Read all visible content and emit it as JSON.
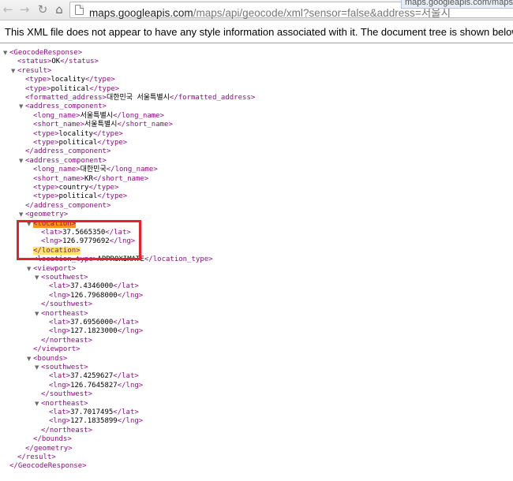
{
  "browser": {
    "url_host": "maps.googleapis.com",
    "url_path": "/maps/api/geocode/xml?sensor=false&address=서울시",
    "hover_url": "maps.googleapis.com/maps/api/"
  },
  "notice": "This XML file does not appear to have any style information associated with it. The document tree is shown below.",
  "xml_lines": [
    "<GeocodeResponse>",
    "<status>OK</status>",
    "<result>",
    "<type>locality</type>",
    "<type>political</type>",
    "<formatted_address>대한민국 서울특별시</formatted_address>",
    "<address_component>",
    "<long_name>서울특별시</long_name>",
    "<short_name>서울특별시</short_name>",
    "<type>locality</type>",
    "<type>political</type>",
    "</address_component>",
    "<address_component>",
    "<long_name>대한민국</long_name>",
    "<short_name>KR</short_name>",
    "<type>country</type>",
    "<type>political</type>",
    "</address_component>",
    "<geometry>",
    "<location>",
    "<lat>37.5665350</lat>",
    "<lng>126.9779692</lng>",
    "</location>",
    "<location_type>APPROXIMATE</location_type>",
    "<viewport>",
    "<southwest>",
    "<lat>37.4346000</lat>",
    "<lng>126.7968000</lng>",
    "</southwest>",
    "<northeast>",
    "<lat>37.6956000</lat>",
    "<lng>127.1823000</lng>",
    "</northeast>",
    "</viewport>",
    "<bounds>",
    "<southwest>",
    "<lat>37.4259627</lat>",
    "<lng>126.7645827</lng>",
    "</southwest>",
    "<northeast>",
    "<lat>37.7017495</lat>",
    "<lng>127.1835899</lng>",
    "</northeast>",
    "</bounds>",
    "</geometry>",
    "</result>",
    "</GeocodeResponse>"
  ],
  "colors": {
    "tag": "#881280",
    "text": "#000000",
    "highlight": "#f7931e",
    "highlight_soft": "#ffe36b",
    "annotation_box": "#e8212a"
  },
  "icons": [
    "back-arrow-icon",
    "forward-arrow-icon",
    "reload-icon",
    "home-icon",
    "page-icon",
    "collapse-triangle-icon"
  ]
}
